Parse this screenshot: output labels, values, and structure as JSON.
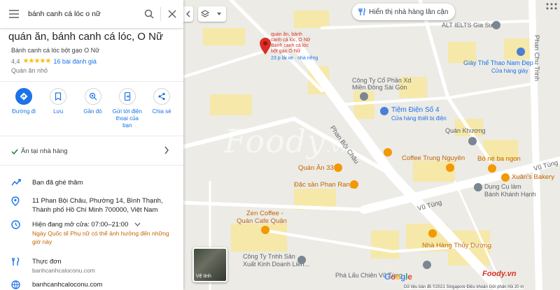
{
  "search": {
    "query": "bánh canh cá lóc o nữ"
  },
  "place": {
    "title": "quán ăn, bánh canh cá lóc, O Nữ",
    "subtitle": "Bánh canh cá lóc bột gạo O Nữ",
    "rating": "4,4",
    "stars": "★★★★★",
    "reviews": "16 bài đánh giá",
    "category": "Quán ăn nhỏ"
  },
  "actions": [
    {
      "label": "Đường đi",
      "icon": "directions-icon"
    },
    {
      "label": "Lưu",
      "icon": "bookmark-icon"
    },
    {
      "label": "Gần đó",
      "icon": "nearby-icon"
    },
    {
      "label": "Gửi tới điện thoại của bạn",
      "icon": "send-to-phone-icon"
    },
    {
      "label": "Chia sẻ",
      "icon": "share-icon"
    }
  ],
  "dine_in": "Ăn tại nhà hàng",
  "info": {
    "visited": "Bạn đã ghé thăm",
    "address_line1": "11 Phan Bội Châu, Phường 14, Bình Thạnh,",
    "address_line2": "Thành phố Hồ Chí Minh 700000, Việt Nam",
    "hours_label": "Hiện đang mở cửa:",
    "hours_value": "07:00–21:00",
    "hours_note": "Ngày Quốc tế Phụ nữ có thể ảnh hưởng đến những giờ này",
    "menu_label": "Thực đơn",
    "menu_url": "banhcanhcaloconu.com",
    "website": "banhcanhcaloconu.com"
  },
  "map": {
    "chip": "Hiển thị nhà hàng lân cận",
    "pin_label_lines": [
      "quán ăn, bánh",
      "canh cá lóc, O Nữ",
      "Bánh canh cá lóc",
      "bột gạo O Nữ"
    ],
    "pin_meta": "23 p lái xe · nhà riêng",
    "labels": {
      "alt_ielts": "ALT IELTS Gia Sư",
      "giay": "Giày Thể Thao Nam Đẹp",
      "giay_sub": "Cửa hàng giày",
      "cong_ty_co_phan": "Công Ty Cổ Phần Xd",
      "cong_ty_co_phan_2": "Miền Đông Sài Gòn",
      "tiem_dien": "Tiệm Điện Số 4",
      "tiem_dien_sub": "Cửa hàng thiết bị điện",
      "quan_khuong": "Quán Khương",
      "coffee_trung": "Coffee Trung Nguyên",
      "bo_ne": "Bò né ba ngon",
      "xuan_bakery": "Xuân's Bakery",
      "quan_an_33": "Quán Ăn 33",
      "dac_san": "Đặc sản Phan Rang",
      "dung_cu": "Dụng Cụ làm",
      "dung_cu_2": "Bánh Khánh Hạnh",
      "zen_coffee": "Zen Coffee -",
      "zen_coffee_2": "Quán Cafe Quận",
      "nha_hang_thuy": "Nhà Hàng Thủy Dương",
      "cong_ty_tnhh": "Công Ty Tnhh Sản",
      "cong_ty_tnhh_2": "Xuất Kinh Doanh Liên...",
      "pha_lau": "Phá Lấu Chiên Vũ Tùng",
      "street_phan_boi_chau": "Phan Bội Châu",
      "street_vu_tung": "Vũ Tùng",
      "street_vu_tung_2": "Vũ Tùng",
      "street_phan_chu_trinh": "Phan Chu Trinh"
    },
    "satellite_label": "Vệ tinh",
    "google": "Google",
    "footer": "Dữ liệu bản đồ ©2021  Singapore  Điều khoản  Gửi phản hồi  20 m",
    "watermark": "Foody",
    "watermark_suffix": ".vn",
    "foody_badge": "Foody.vn"
  },
  "colors": {
    "accent": "#1a73e8",
    "pin_red": "#d93025",
    "food_orange": "#f29900"
  }
}
